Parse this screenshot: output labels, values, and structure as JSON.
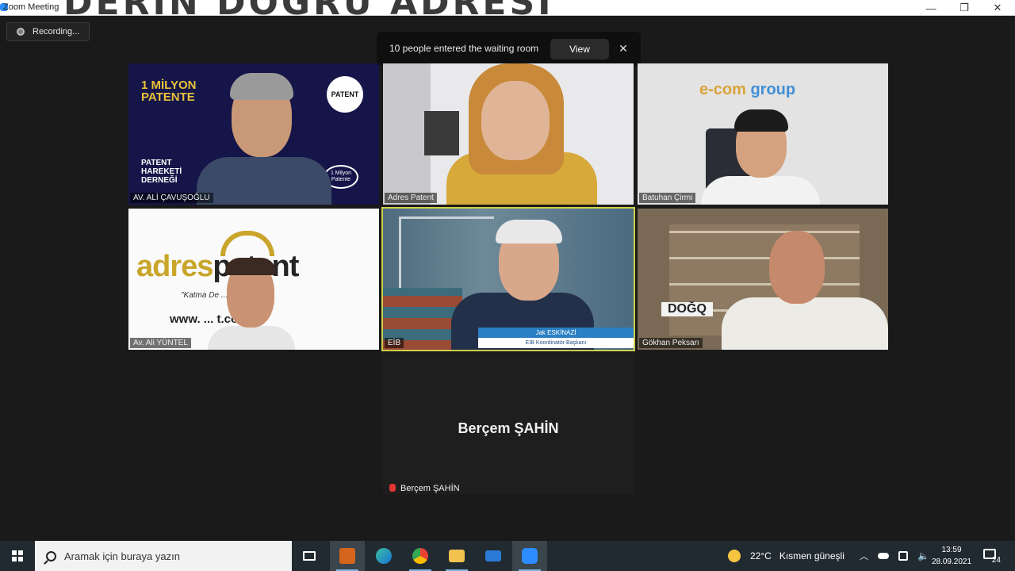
{
  "window": {
    "title": "Zoom Meeting",
    "banner_text": "DERİN DOĞRU ADRESİ",
    "controls": {
      "minimize": "—",
      "maximize": "❐",
      "close": "✕"
    }
  },
  "recording": {
    "label": "Recording..."
  },
  "notification": {
    "message": "10 people entered the waiting room",
    "view_label": "View",
    "close_label": "✕"
  },
  "participants": [
    {
      "name": "AV. ALİ ÇAVUŞOĞLU",
      "poster_title": "1 MİLYON PATENTE",
      "poster_sub": "PATENT HAREKETİ DERNEĞİ",
      "badge1": "PATENT",
      "badge2": "1 Milyon Patente"
    },
    {
      "name": "Adres Patent"
    },
    {
      "name": "Batuhan Çirmi",
      "logo_left": "e-com ",
      "logo_right": "group"
    },
    {
      "name": "Av. Ali YÜNTEL",
      "brand_left": "adres",
      "brand_right": "patent",
      "tagline": "\"Katma De ... not Merkezi\"",
      "web": "www. ... t.com.tr"
    },
    {
      "name": "EİB",
      "lower_name": "Jak ESKİNAZİ",
      "lower_title": "EİB Koordinatör Başkanı"
    },
    {
      "name": "Gökhan Peksarı",
      "sign": "DOĞQ"
    },
    {
      "name": "Berçem ŞAHİN",
      "center_name": "Berçem ŞAHİN"
    }
  ],
  "taskbar": {
    "search_placeholder": "Aramak için buraya yazın",
    "apps": [
      "task-view",
      "outlook",
      "edge",
      "chrome",
      "file-explorer",
      "mail",
      "zoom"
    ],
    "weather_temp": "22°C",
    "weather_text": "Kısmen güneşli",
    "time": "13:59",
    "date": "28.09.2021",
    "notifications_count": "24"
  },
  "colors": {
    "meeting_bg": "#1a1a1a",
    "active_speaker_border": "#cdd04a",
    "taskbar_bg": "#202a30",
    "zoom_blue": "#2d8cff"
  }
}
